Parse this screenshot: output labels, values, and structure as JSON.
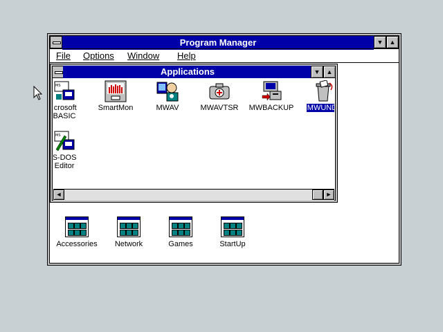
{
  "program_manager": {
    "title": "Program Manager",
    "minimize_glyph": "▼",
    "maximize_glyph": "▲",
    "menu": [
      "File",
      "Options",
      "Window",
      "Help"
    ]
  },
  "applications": {
    "title": "Applications",
    "minimize_glyph": "▼",
    "maximize_glyph": "▲",
    "items": [
      {
        "label": "icrosoft\nBASIC",
        "icon": "qbasic-icon"
      },
      {
        "label": "SmartMon",
        "icon": "smartmon-icon"
      },
      {
        "label": "MWAV",
        "icon": "mwav-icon"
      },
      {
        "label": "MWAVTSR",
        "icon": "mwavtsr-icon"
      },
      {
        "label": "MWBACKUP",
        "icon": "mwbackup-icon"
      },
      {
        "label": "MWUNDI",
        "icon": "mwundelete-icon",
        "selected": true
      },
      {
        "label": "S-DOS\nEditor",
        "icon": "msdos-editor-icon"
      }
    ],
    "scroll_left_glyph": "◄",
    "scroll_right_glyph": "►"
  },
  "groups": [
    {
      "label": "Accessories",
      "icon": "program-group-icon"
    },
    {
      "label": "Network",
      "icon": "program-group-icon"
    },
    {
      "label": "Games",
      "icon": "program-group-icon"
    },
    {
      "label": "StartUp",
      "icon": "program-group-icon"
    }
  ],
  "colors": {
    "desktop": "#c8d0d4",
    "titlebar": "#0000a8",
    "selection": "#0000a8"
  }
}
